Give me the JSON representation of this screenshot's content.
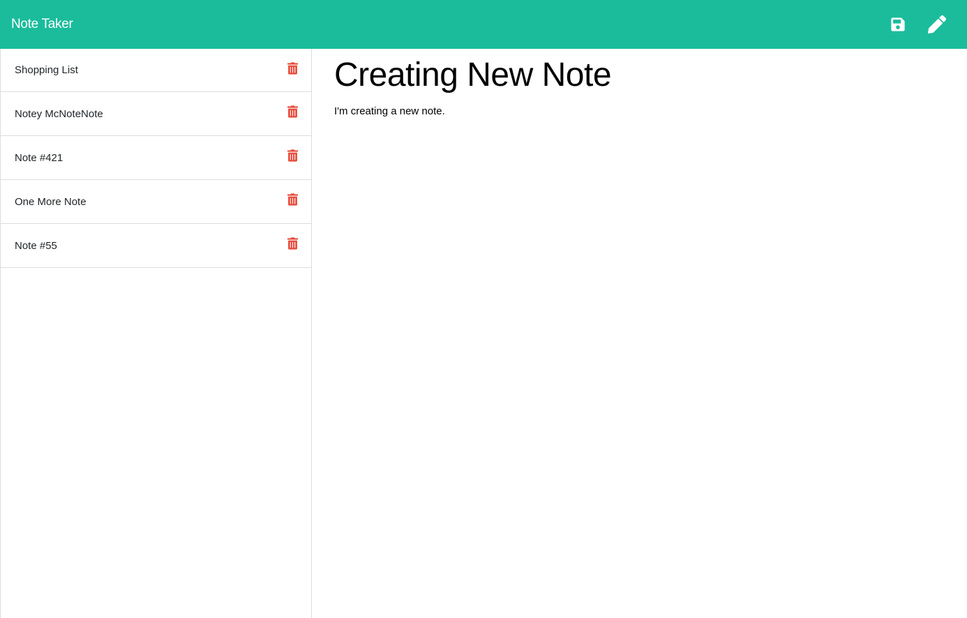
{
  "app": {
    "title": "Note Taker",
    "accent_color": "#1abc9c",
    "delete_color": "#e74c3c"
  },
  "toolbar": {
    "save_icon": "save-icon",
    "edit_icon": "pencil-icon"
  },
  "sidebar": {
    "notes": [
      {
        "title": "Shopping List"
      },
      {
        "title": "Notey McNoteNote"
      },
      {
        "title": "Note #421"
      },
      {
        "title": "One More Note"
      },
      {
        "title": "Note #55"
      }
    ],
    "delete_icon": "trash-icon"
  },
  "editor": {
    "title": "Creating New Note",
    "text": "I'm creating a new note."
  }
}
